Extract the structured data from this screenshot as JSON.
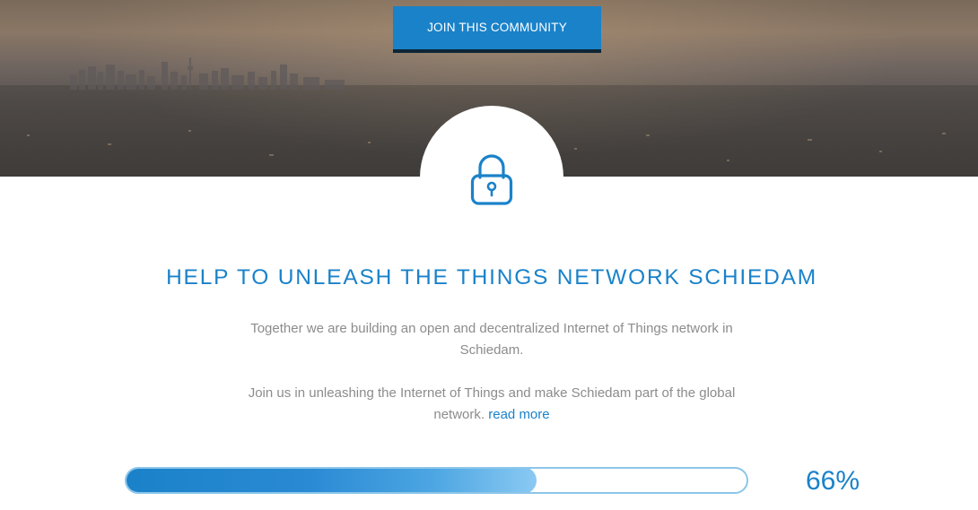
{
  "hero": {
    "join_button_label": "JOIN THIS COMMUNITY"
  },
  "icon": {
    "name": "lock-icon",
    "color": "#1a82c9"
  },
  "main": {
    "headline": "HELP TO UNLEASH THE THINGS NETWORK SCHIEDAM",
    "paragraph_1": "Together we are building an open and decentralized Internet of Things network in Schiedam.",
    "paragraph_2": "Join us in unleashing the Internet of Things and make Schiedam part of the global network.",
    "read_more_label": "read more"
  },
  "progress": {
    "value_percent": 66,
    "label": "66%"
  },
  "colors": {
    "accent": "#1a82c9",
    "body_text": "#8c8c8c",
    "progress_border": "#8cc6ea"
  }
}
